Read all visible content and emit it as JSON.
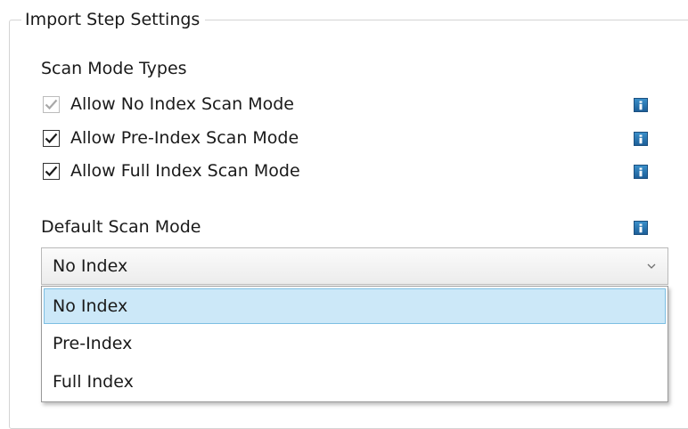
{
  "group": {
    "title": "Import Step Settings"
  },
  "scan_mode_types": {
    "title": "Scan Mode Types",
    "options": [
      {
        "label": "Allow No Index Scan Mode",
        "checked": true,
        "disabled": true
      },
      {
        "label": "Allow Pre-Index Scan Mode",
        "checked": true,
        "disabled": false
      },
      {
        "label": "Allow Full Index Scan Mode",
        "checked": true,
        "disabled": false
      }
    ]
  },
  "default_scan_mode": {
    "title": "Default Scan Mode",
    "selected_value": "No Index",
    "options": [
      "No Index",
      "Pre-Index",
      "Full Index"
    ],
    "highlighted_option": "No Index"
  },
  "icons": {
    "info": "info-icon",
    "checkmark": "checkmark-icon",
    "dropdown": "chevron-down-icon"
  },
  "colors": {
    "info_icon": "#2a78b5",
    "selection_background": "#cce8f8",
    "selection_border": "#7dbfe3",
    "disabled_check": "#a8a8a8"
  }
}
